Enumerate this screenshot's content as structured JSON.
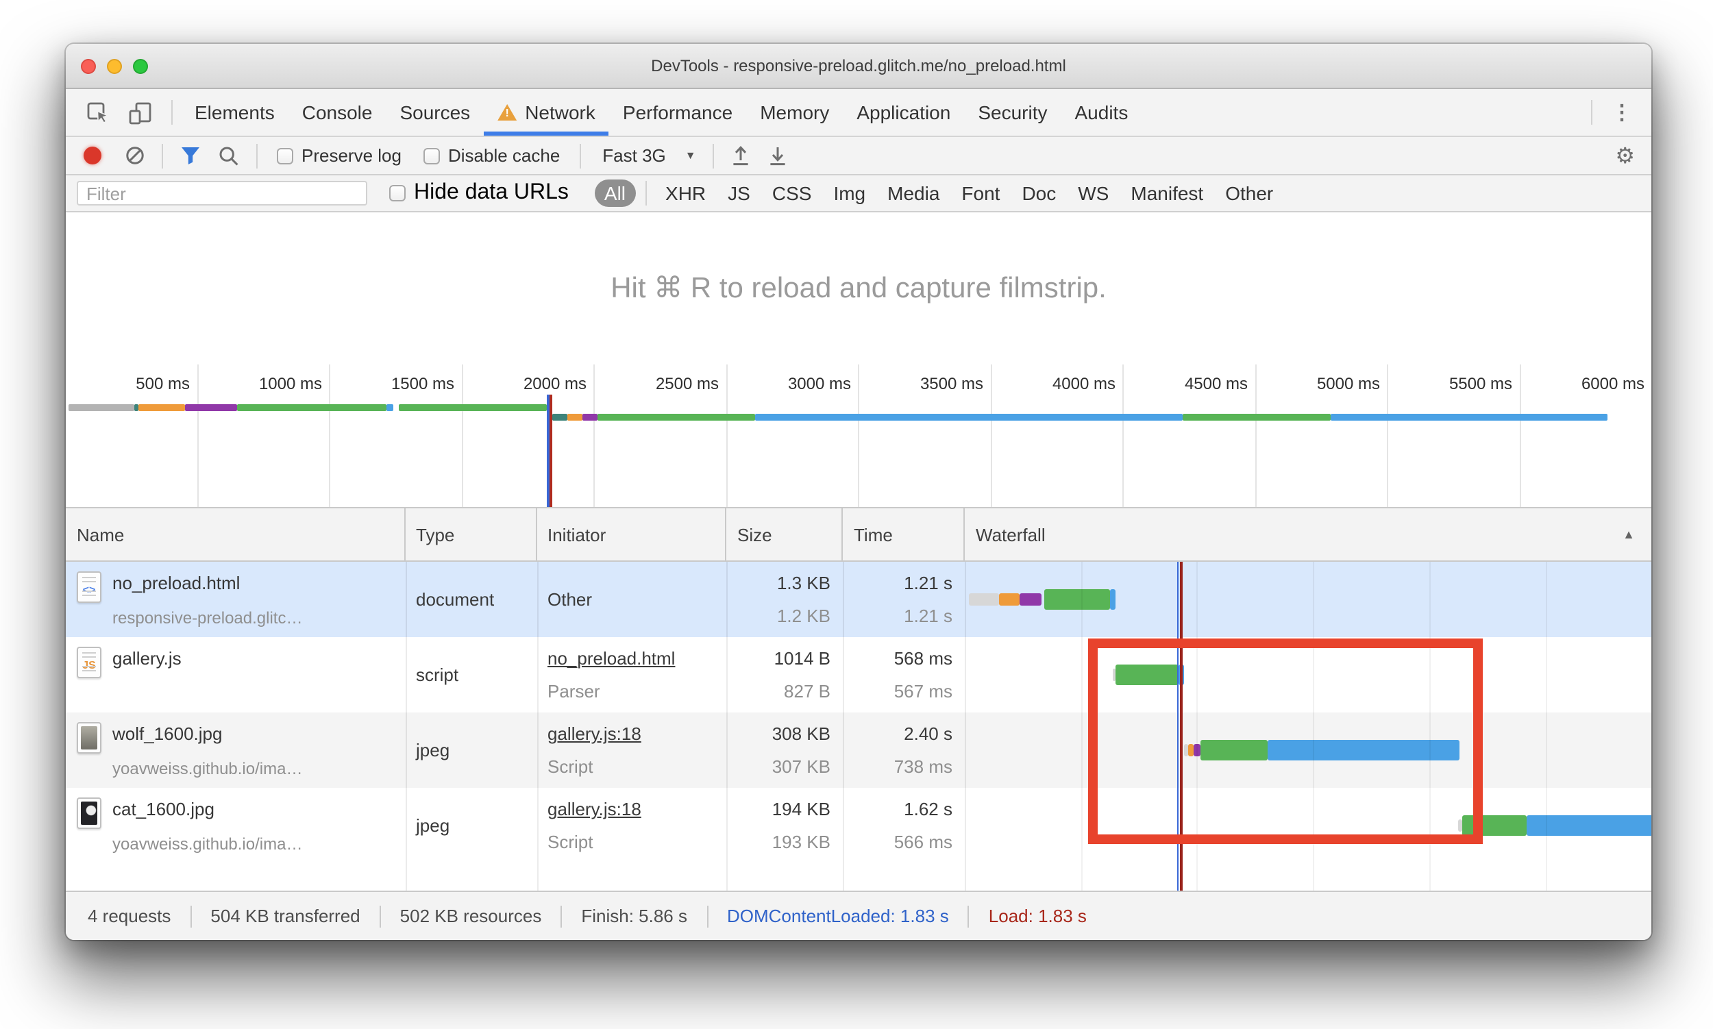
{
  "window": {
    "title": "DevTools - responsive-preload.glitch.me/no_preload.html"
  },
  "tabs": [
    {
      "label": "Elements"
    },
    {
      "label": "Console"
    },
    {
      "label": "Sources"
    },
    {
      "label": "Network",
      "active": true,
      "warning": true
    },
    {
      "label": "Performance"
    },
    {
      "label": "Memory"
    },
    {
      "label": "Application"
    },
    {
      "label": "Security"
    },
    {
      "label": "Audits"
    }
  ],
  "toolbar": {
    "preserve_log_label": "Preserve log",
    "disable_cache_label": "Disable cache",
    "throttling_value": "Fast 3G"
  },
  "filter_bar": {
    "filter_placeholder": "Filter",
    "hide_data_urls_label": "Hide data URLs",
    "type_filters": [
      "All",
      "XHR",
      "JS",
      "CSS",
      "Img",
      "Media",
      "Font",
      "Doc",
      "WS",
      "Manifest",
      "Other"
    ],
    "selected_filter": "All"
  },
  "empty_message": "Hit ⌘ R to reload and capture filmstrip.",
  "overview": {
    "tick_labels": [
      "500 ms",
      "1000 ms",
      "1500 ms",
      "2000 ms",
      "2500 ms",
      "3000 ms",
      "3500 ms",
      "4000 ms",
      "4500 ms",
      "5000 ms",
      "5500 ms",
      "6000 ms"
    ],
    "lines": [
      {
        "segments": [
          {
            "c": "gray",
            "a": 0.17,
            "b": 4.33
          },
          {
            "c": "teal",
            "a": 4.33,
            "b": 4.6
          },
          {
            "c": "orange",
            "a": 4.6,
            "b": 7.48
          },
          {
            "c": "purple",
            "a": 7.48,
            "b": 10.77
          },
          {
            "c": "green",
            "a": 10.77,
            "b": 20.24
          },
          {
            "c": "blue",
            "a": 20.24,
            "b": 20.7
          },
          {
            "c": "green",
            "a": 21.0,
            "b": 30.36
          }
        ]
      },
      {
        "segments": [
          {
            "c": "teal",
            "a": 30.67,
            "b": 31.62
          },
          {
            "c": "orange",
            "a": 31.62,
            "b": 32.57
          },
          {
            "c": "purple",
            "a": 32.57,
            "b": 33.56
          },
          {
            "c": "green",
            "a": 33.56,
            "b": 43.5
          },
          {
            "c": "blue",
            "a": 43.5,
            "b": 70.42
          },
          {
            "c": "green",
            "a": 70.42,
            "b": 79.76
          },
          {
            "c": "blue",
            "a": 79.76,
            "b": 97.23
          }
        ]
      }
    ],
    "dcl_line_pct": 30.36,
    "load_line_pct": 30.55
  },
  "table": {
    "columns": [
      "Name",
      "Type",
      "Initiator",
      "Size",
      "Time",
      "Waterfall"
    ],
    "waterfall_scale_s": 5.9,
    "load_line_s": 1.85,
    "grid_seconds": [
      1,
      2,
      3,
      4,
      5
    ],
    "rows": [
      {
        "icon": "html-doc",
        "name": "no_preload.html",
        "sub": "responsive-preload.glitc…",
        "type": "document",
        "initiator": "Other",
        "initiator_link": false,
        "initiator_sub": "",
        "size": "1.3 KB",
        "size_sub": "1.2 KB",
        "time": "1.21 s",
        "time_sub": "1.21 s",
        "selected": true,
        "waterfall": [
          {
            "c": "lightgray",
            "a": 0.03,
            "b": 0.3,
            "thin": true
          },
          {
            "c": "orange",
            "a": 0.3,
            "b": 0.47,
            "thin": true
          },
          {
            "c": "purple",
            "a": 0.47,
            "b": 0.66,
            "thin": true
          },
          {
            "c": "green",
            "a": 0.68,
            "b": 1.25
          },
          {
            "c": "blue",
            "a": 1.25,
            "b": 1.3
          }
        ]
      },
      {
        "icon": "js-file",
        "name": "gallery.js",
        "sub": "",
        "type": "script",
        "initiator": "no_preload.html",
        "initiator_link": true,
        "initiator_sub": "Parser",
        "size": "1014 B",
        "size_sub": "827 B",
        "time": "568 ms",
        "time_sub": "567 ms",
        "waterfall": [
          {
            "c": "lightgray",
            "a": 1.27,
            "b": 1.3,
            "thin": true
          },
          {
            "c": "green",
            "a": 1.3,
            "b": 1.84
          },
          {
            "c": "blue",
            "a": 1.84,
            "b": 1.88
          }
        ]
      },
      {
        "icon": "wolf-image",
        "name": "wolf_1600.jpg",
        "sub": "yoavweiss.github.io/ima…",
        "type": "jpeg",
        "initiator": "gallery.js:18",
        "initiator_link": true,
        "initiator_sub": "Script",
        "size": "308 KB",
        "size_sub": "307 KB",
        "time": "2.40 s",
        "time_sub": "738 ms",
        "shaded": true,
        "waterfall": [
          {
            "c": "lightgray",
            "a": 1.88,
            "b": 1.92,
            "thin": true
          },
          {
            "c": "orange",
            "a": 1.92,
            "b": 1.97,
            "thin": true
          },
          {
            "c": "purple",
            "a": 1.97,
            "b": 2.03,
            "thin": true
          },
          {
            "c": "green",
            "a": 2.03,
            "b": 2.6
          },
          {
            "c": "blue",
            "a": 2.6,
            "b": 4.25
          }
        ]
      },
      {
        "icon": "cat-image",
        "name": "cat_1600.jpg",
        "sub": "yoavweiss.github.io/ima…",
        "type": "jpeg",
        "initiator": "gallery.js:18",
        "initiator_link": true,
        "initiator_sub": "Script",
        "size": "194 KB",
        "size_sub": "193 KB",
        "time": "1.62 s",
        "time_sub": "566 ms",
        "waterfall": [
          {
            "c": "lightgray",
            "a": 4.24,
            "b": 4.27,
            "thin": true
          },
          {
            "c": "green",
            "a": 4.27,
            "b": 4.83
          },
          {
            "c": "blue",
            "a": 4.83,
            "b": 5.93
          }
        ]
      }
    ]
  },
  "status_bar": {
    "items": [
      {
        "text": "4 requests"
      },
      {
        "text": "504 KB transferred"
      },
      {
        "text": "502 KB resources"
      },
      {
        "text": "Finish: 5.86 s"
      },
      {
        "text": "DOMContentLoaded: 1.83 s",
        "color": "blue"
      },
      {
        "text": "Load: 1.83 s",
        "color": "red"
      }
    ]
  },
  "colors": {
    "green": "#58b456",
    "blue": "#4aa1e5",
    "orange": "#ef9b3a",
    "purple": "#9038a8",
    "gray": "#b3b3b3",
    "teal": "#3e837a",
    "lightgray": "#d7d7d7",
    "accent_blue": "#3e7de8",
    "dcl_line_blue": "#3968d6",
    "load_line_red": "#9a231c",
    "annotation_red": "#e8432c",
    "status_blue": "#2f62c9",
    "status_red": "#a8271a",
    "selected_row": "#d9e8fc"
  }
}
